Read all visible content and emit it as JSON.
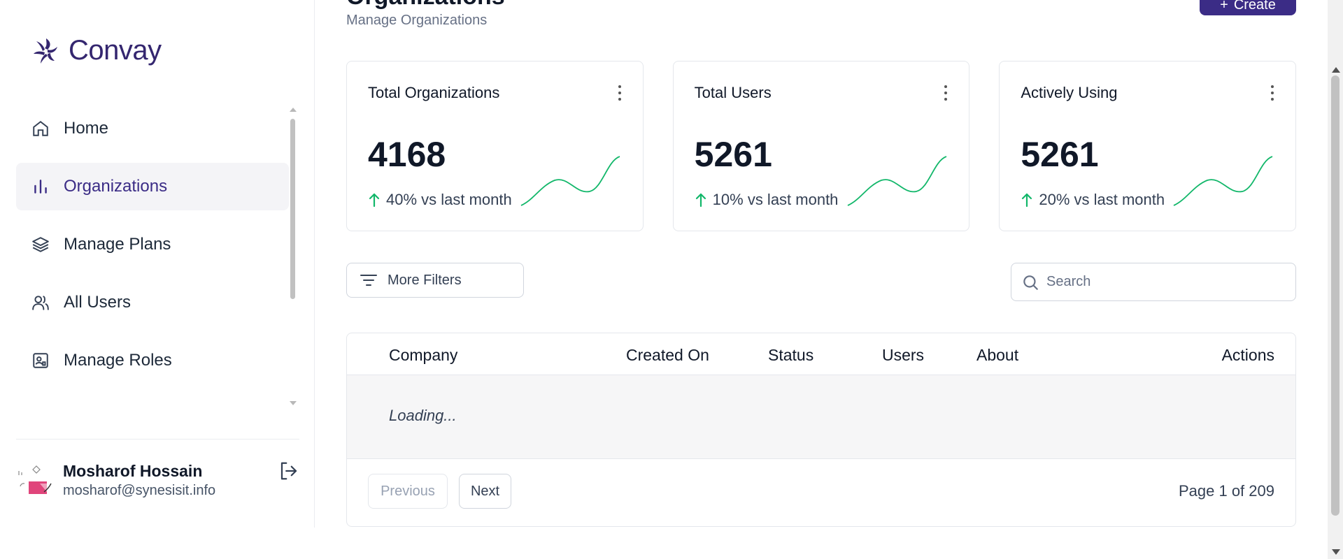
{
  "brand": {
    "name": "Convay",
    "color": "#34266f"
  },
  "sidebar": {
    "items": [
      {
        "label": "Home",
        "icon": "home-icon",
        "active": false
      },
      {
        "label": "Organizations",
        "icon": "bar-chart-icon",
        "active": true
      },
      {
        "label": "Manage Plans",
        "icon": "layers-icon",
        "active": false
      },
      {
        "label": "All Users",
        "icon": "users-icon",
        "active": false
      },
      {
        "label": "Manage Roles",
        "icon": "role-badge-icon",
        "active": false
      }
    ]
  },
  "user": {
    "name": "Mosharof Hossain",
    "email": "mosharof@synesisit.info"
  },
  "header": {
    "subtitle": "Manage Organizations",
    "create_label": "Create"
  },
  "stats": [
    {
      "title": "Total Organizations",
      "value": "4168",
      "trend": "40% vs last month"
    },
    {
      "title": "Total Users",
      "value": "5261",
      "trend": "10% vs last month"
    },
    {
      "title": "Actively Using",
      "value": "5261",
      "trend": "20% vs last month"
    }
  ],
  "filters": {
    "more_filters_label": "More Filters",
    "search_placeholder": "Search"
  },
  "table": {
    "columns": [
      "Company",
      "Created On",
      "Status",
      "Users",
      "About",
      "Actions"
    ],
    "loading_text": "Loading...",
    "prev_label": "Previous",
    "next_label": "Next",
    "page_info": "Page 1 of 209"
  },
  "colors": {
    "accent": "#3b2c86",
    "trend_up": "#12b76a",
    "sparkline": "#12b76a"
  }
}
